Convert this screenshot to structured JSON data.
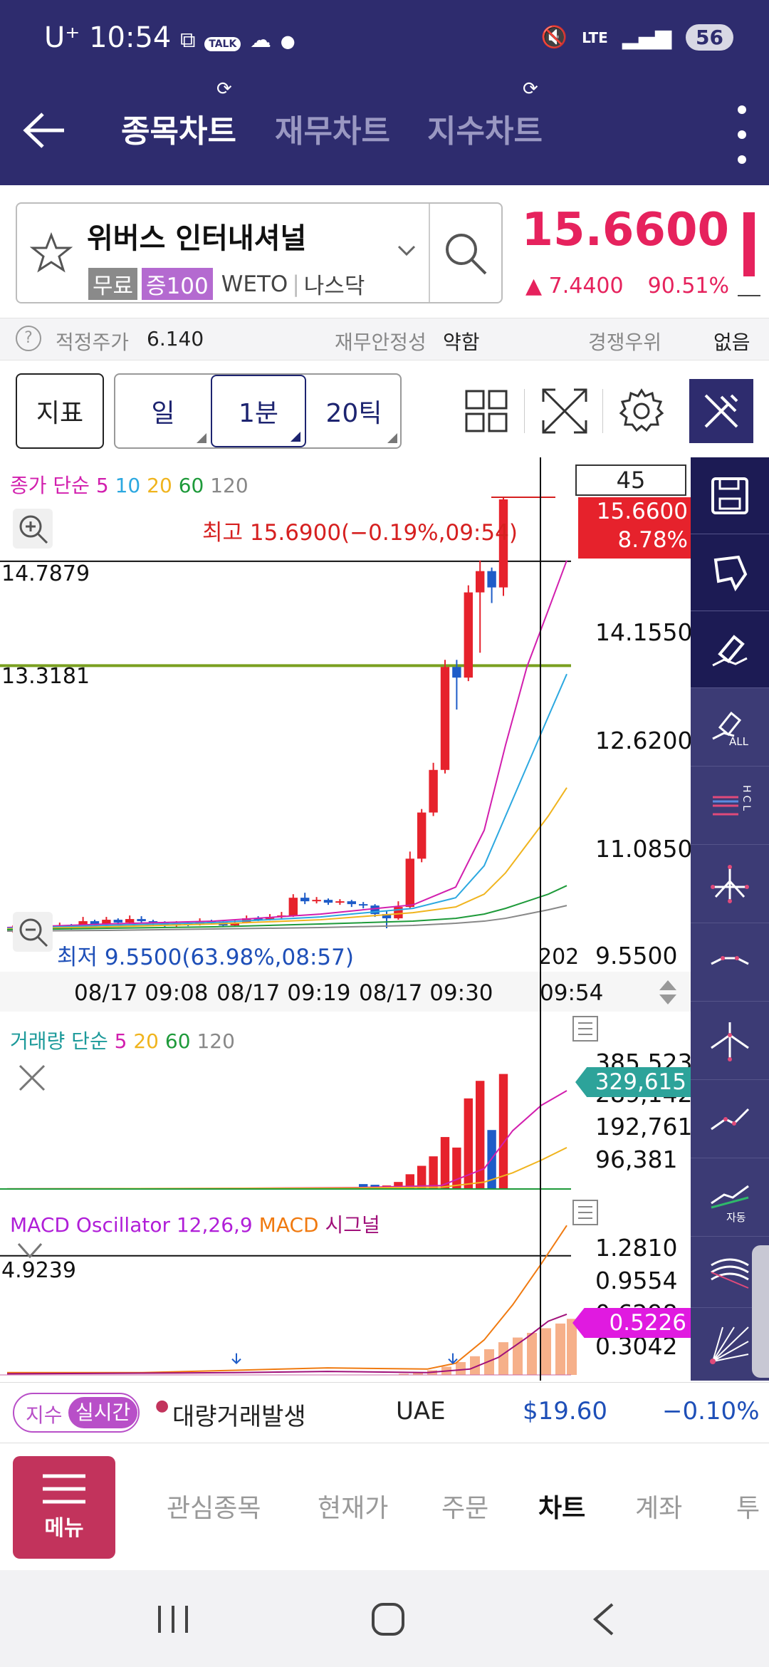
{
  "status_bar": {
    "carrier": "U⁺",
    "time": "10:54",
    "talk": "TALK",
    "network": "LTE",
    "battery": "56"
  },
  "header": {
    "tabs": [
      "종목차트",
      "재무차트",
      "지수차트"
    ],
    "active_tab": 0
  },
  "stock": {
    "name": "위버스 인터내셔널",
    "tags": [
      "무료",
      "증100"
    ],
    "ticker": "WETO",
    "exchange": "나스닥",
    "price": "15.6600",
    "change": "▲ 7.4400",
    "change_pct": "90.51%"
  },
  "info_bar": {
    "fair_value_label": "적정주가",
    "fair_value": "6.140",
    "stability_label": "재무안정성",
    "stability": "약함",
    "competition_label": "경쟁우위",
    "competition": "없음"
  },
  "toolbar": {
    "indicator": "지표",
    "day": "일",
    "minute": "1분",
    "tick": "20틱"
  },
  "price_chart": {
    "legend_label": "종가 단순",
    "ma_periods": [
      "5",
      "10",
      "20",
      "60",
      "120"
    ],
    "ma_colors": [
      "#d21fae",
      "#2ca8e0",
      "#f0b41e",
      "#1e9a3a",
      "#888888"
    ],
    "count_box": "45",
    "current_price": "15.6600",
    "current_pct": "8.78%",
    "high_note": "최고 15.6900(−0.19%,09:54)",
    "low_note": "최저 9.5500(63.98%,08:57)",
    "hline_black": "14.7879",
    "hline_green": "13.3181",
    "y_ticks": [
      "14.1550",
      "12.6200",
      "11.0850",
      "9.5500"
    ],
    "x_ticks": [
      "08/17 09:08",
      "08/17 09:19",
      "08/17 09:30",
      "09:54"
    ],
    "partial_label": "202"
  },
  "volume_chart": {
    "legend_label": "거래량 단순",
    "ma_periods": [
      "5",
      "20",
      "60",
      "120"
    ],
    "current": "329,615",
    "y_ticks": [
      "385,523",
      "289,142",
      "192,761",
      "96,381"
    ]
  },
  "macd_chart": {
    "legend_osc": "MACD Oscillator 12,26,9",
    "legend_macd": "MACD",
    "legend_signal": "시그널",
    "hline": "4.9239",
    "current": "0.5226",
    "y_ticks": [
      "1.2810",
      "0.9554",
      "0.6298",
      "0.3042"
    ]
  },
  "tool_labels": {
    "all": "ALL",
    "hcl": "HCL",
    "auto": "자동"
  },
  "ticker": {
    "left_label": "지수",
    "right_label": "실시간",
    "event": "대량거래발생",
    "symbol": "UAE",
    "price": "$19.60",
    "change": "−0.10%"
  },
  "bottom_nav": {
    "menu": "메뉴",
    "items": [
      "관심종목",
      "현재가",
      "주문",
      "차트",
      "계좌",
      "투"
    ],
    "active": 3
  },
  "colors": {
    "primary": "#2e2c6e",
    "up": "#e6225d",
    "down": "#1e5cc8",
    "accent": "#c2335c"
  }
}
